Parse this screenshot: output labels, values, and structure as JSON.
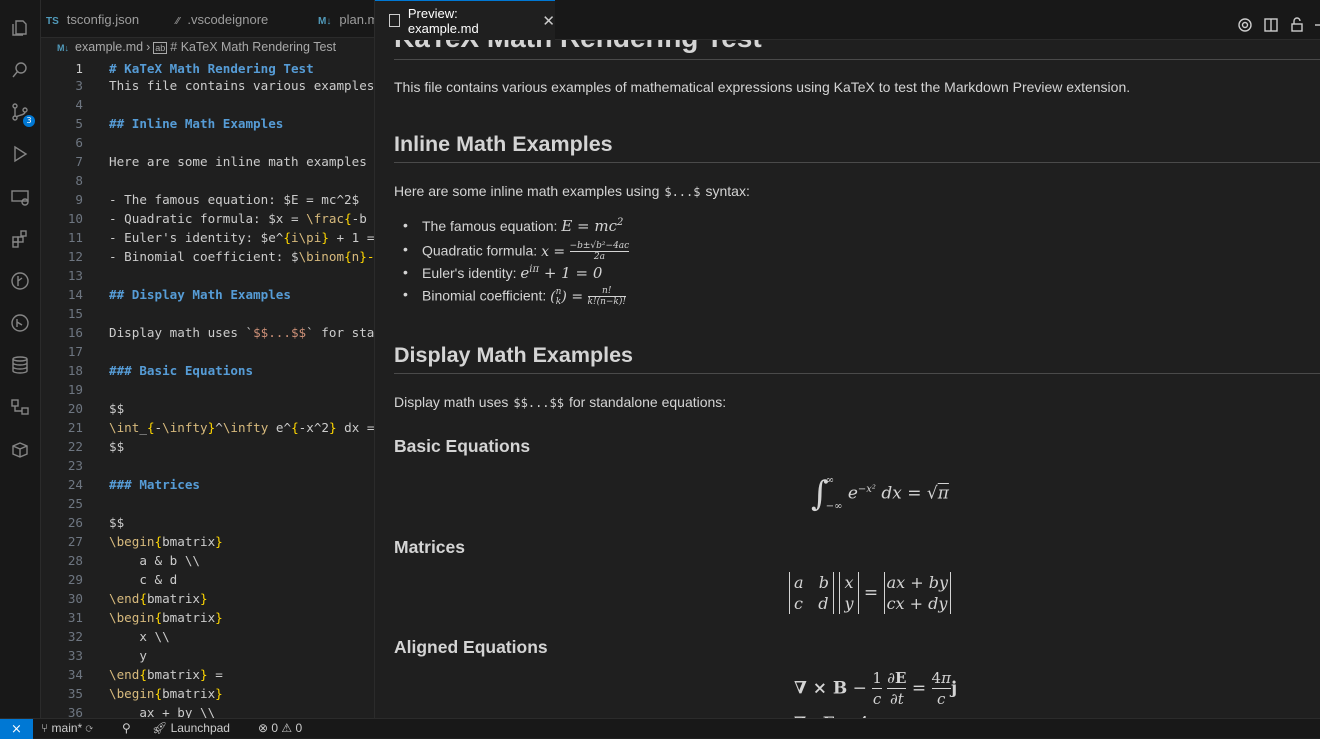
{
  "activity_bar": {
    "icons": [
      "explorer-icon",
      "search-icon",
      "source-control-icon",
      "run-debug-icon",
      "remote-explorer-icon",
      "extensions-icon",
      "git-graph-icon",
      "testing-icon",
      "database-icon",
      "containers-icon",
      "packages-icon"
    ],
    "scm_badge": "3"
  },
  "editor": {
    "tabs": [
      {
        "icon": "TS",
        "label": "tsconfig.json"
      },
      {
        "icon": "⁄⁄",
        "label": ".vscodeignore"
      },
      {
        "icon": "M↓",
        "label": "plan.m"
      }
    ],
    "breadcrumb": {
      "icon": "M↓",
      "file": "example.md",
      "symbol": "# KaTeX Math Rendering Test"
    },
    "line_numbers": [
      "1",
      "3",
      "4",
      "5",
      "6",
      "7",
      "8",
      "9",
      "10",
      "11",
      "12",
      "13",
      "14",
      "15",
      "16",
      "17",
      "18",
      "19",
      "20",
      "21",
      "22",
      "23",
      "24",
      "25",
      "26",
      "27",
      "28",
      "29",
      "30",
      "31",
      "32",
      "33",
      "34",
      "35",
      "36"
    ],
    "lines": {
      "l1": "# KaTeX Math Rendering Test",
      "l3": "This file contains various examples",
      "l5": "## Inline Math Examples",
      "l7": "Here are some inline math examples",
      "l9": "- The famous equation: $E = mc^2$",
      "l10a": "- Quadratic formula: $x = ",
      "l10b": "\\frac",
      "l10c": "{",
      "l10d": "-b",
      "l11a": "- Euler's identity: $e^",
      "l11b": "{",
      "l11c": "i",
      "l11d": "\\pi",
      "l11e": "}",
      "l11f": " + 1 =",
      "l12a": "- Binomial coefficient: $",
      "l12b": "\\binom",
      "l12c": "{",
      "l12d": "n",
      "l12e": "}-",
      "l14": "## Display Math Examples",
      "l16a": "Display math uses `",
      "l16b": "$$...$$",
      "l16c": "` for sta",
      "l18": "### Basic Equations",
      "l20": "$$",
      "l21a": "\\int",
      "l21b": "_",
      "l21c": "{",
      "l21d": "-",
      "l21e": "\\infty",
      "l21f": "}",
      "l21g": "^",
      "l21h": "\\infty",
      "l21i": " e^",
      "l21j": "{",
      "l21k": "-x^2",
      "l21l": "}",
      "l21m": " dx =",
      "l22": "$$",
      "l24": "### Matrices",
      "l26": "$$",
      "l27a": "\\begin",
      "l27b": "{",
      "l27c": "bmatrix",
      "l27d": "}",
      "l28": "    a & b \\\\",
      "l29": "    c & d",
      "l30a": "\\end",
      "l30b": "{",
      "l30c": "bmatrix",
      "l30d": "}",
      "l31a": "\\begin",
      "l31b": "{",
      "l31c": "bmatrix",
      "l31d": "}",
      "l32": "    x \\\\",
      "l33": "    y",
      "l34a": "\\end",
      "l34b": "{",
      "l34c": "bmatrix",
      "l34d": "}",
      "l34e": " =",
      "l35a": "\\begin",
      "l35b": "{",
      "l35c": "bmatrix",
      "l35d": "}",
      "l36": "    ax + by \\\\"
    }
  },
  "preview": {
    "tab_label": "Preview: example.md",
    "close": "✕",
    "toolbar_icons": [
      "settings-icon",
      "split-editor-icon",
      "lock-icon"
    ],
    "h1": "KaTeX Math Rendering Test",
    "intro": "This file contains various examples of mathematical expressions using KaTeX to test the Markdown Preview extension.",
    "inline_heading": "Inline Math Examples",
    "inline_intro_a": "Here are some inline math examples using",
    "inline_intro_code": "$...$",
    "inline_intro_b": "syntax:",
    "items": [
      {
        "label": "The famous equation:"
      },
      {
        "label": "Quadratic formula:"
      },
      {
        "label": "Euler's identity:"
      },
      {
        "label": "Binomial coefficient:"
      }
    ],
    "display_heading": "Display Math Examples",
    "display_intro_a": "Display math uses",
    "display_intro_code": "$$...$$",
    "display_intro_b": "for standalone equations:",
    "basic_heading": "Basic Equations",
    "matrices_heading": "Matrices",
    "aligned_heading": "Aligned Equations"
  },
  "status_bar": {
    "remote_icon": "⨯",
    "branch": "main*",
    "launchpad": "Launchpad",
    "errors": "0",
    "warnings": "0"
  }
}
